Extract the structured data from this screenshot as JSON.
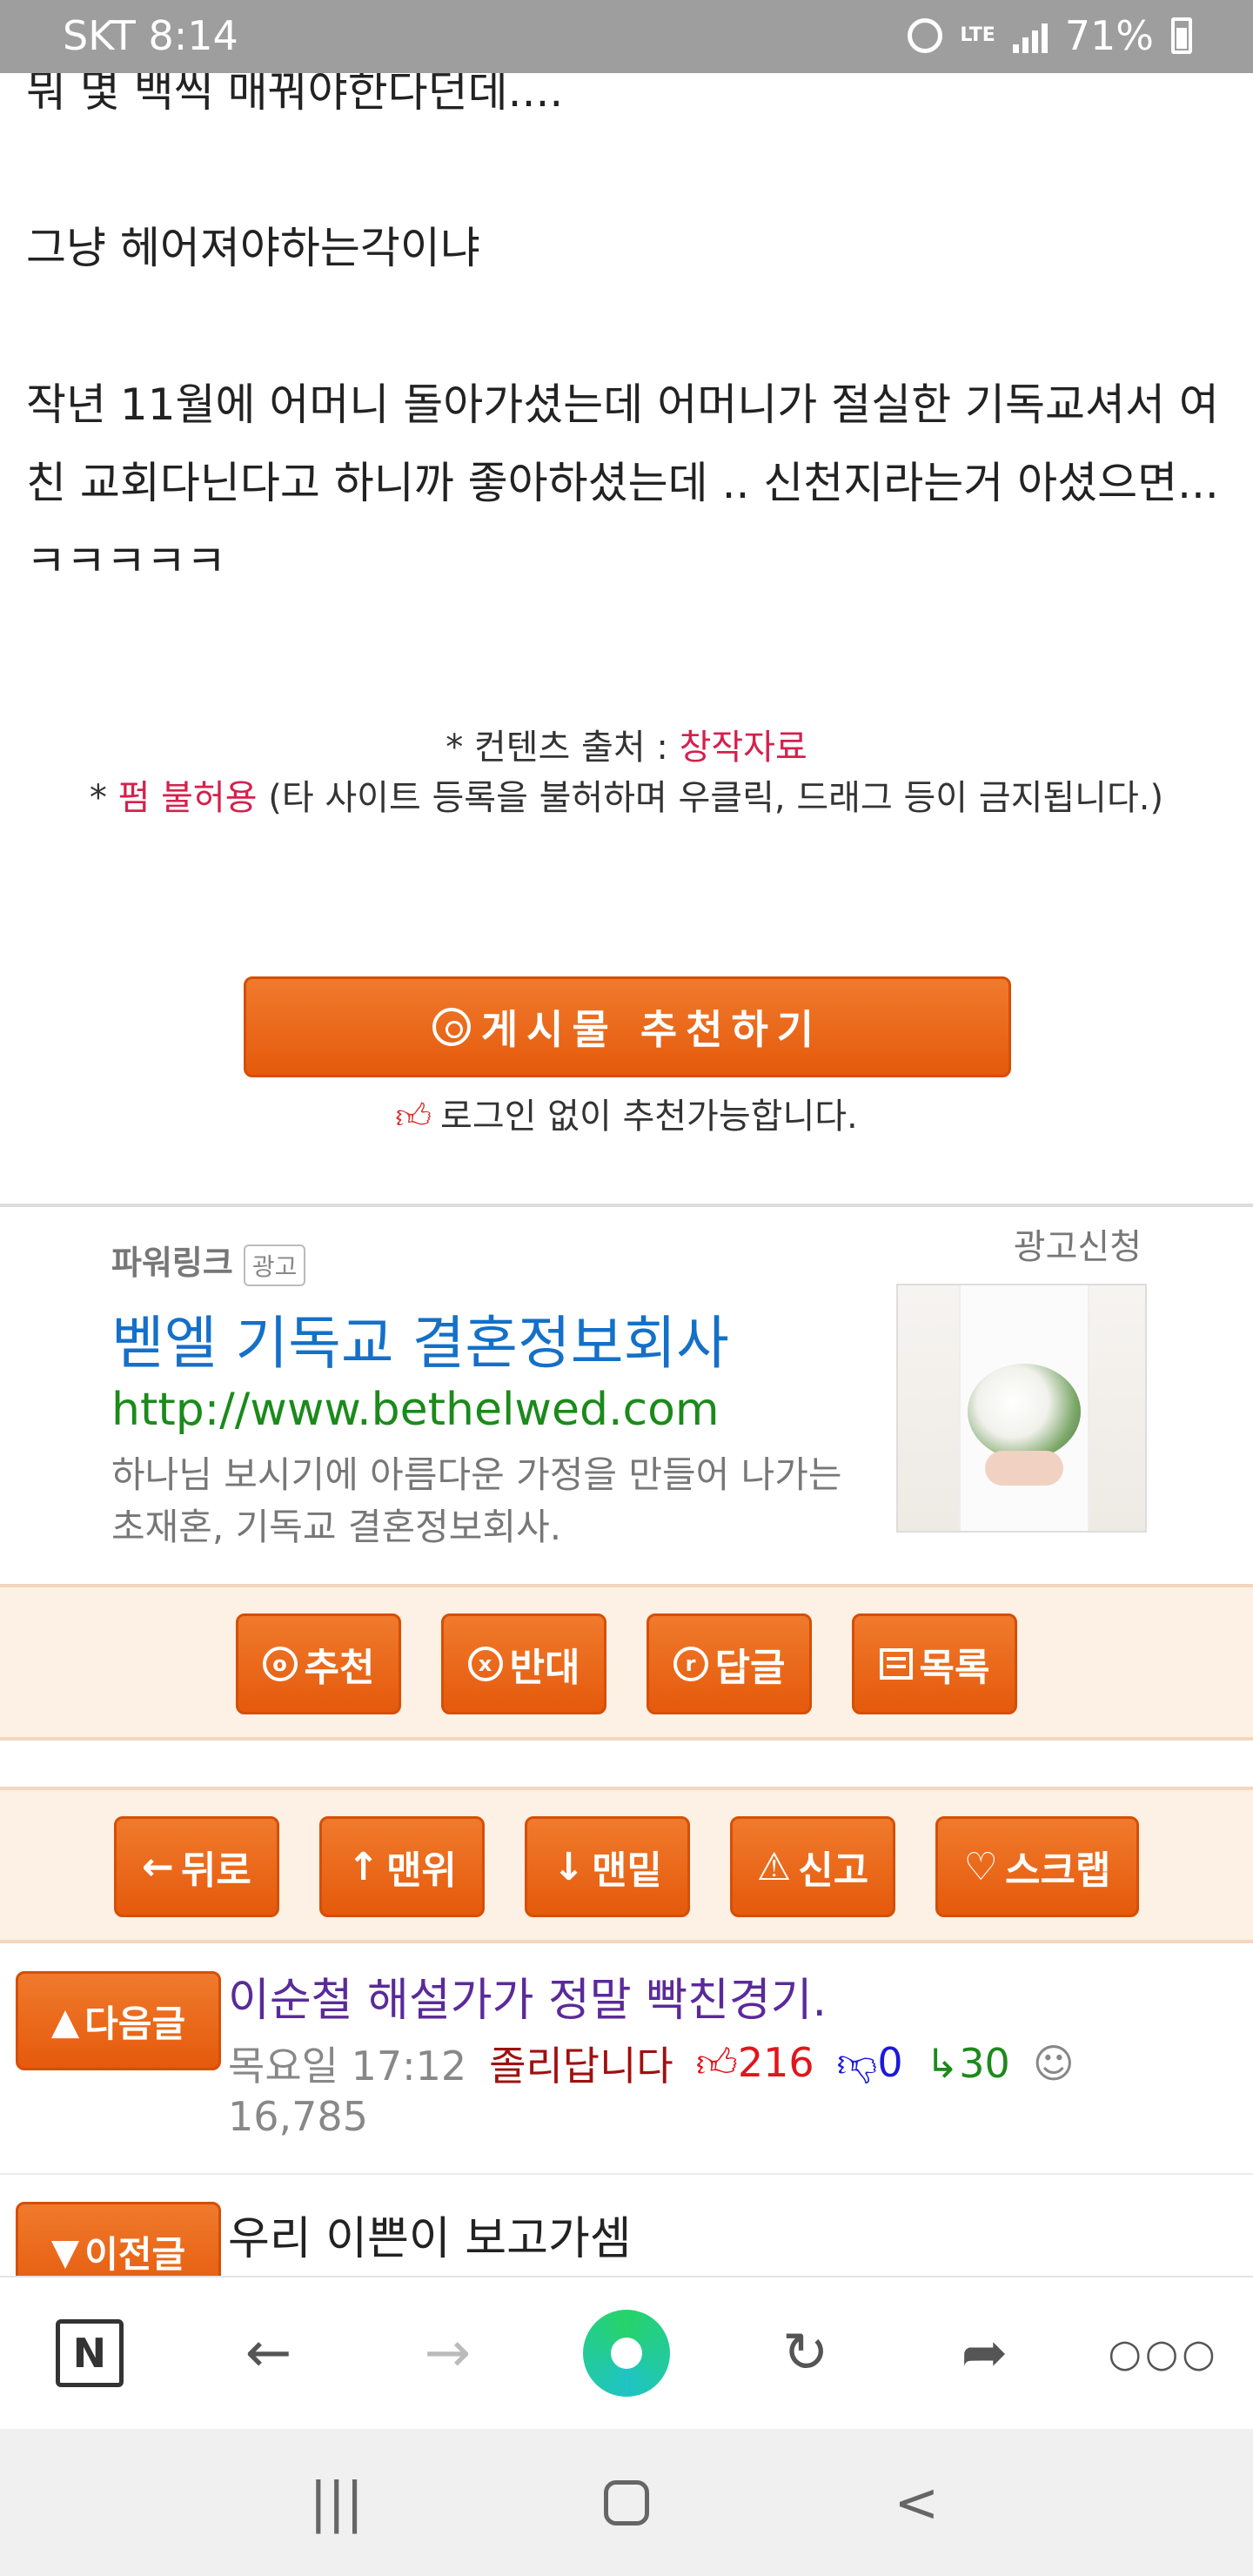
{
  "status_bar": {
    "carrier_time": "SKT 8:14",
    "network": "LTE",
    "battery": "71%"
  },
  "article": {
    "paragraphs": [
      "뭐 몇 백씩 매꿔야한다던데....",
      "그냥 헤어져야하는각이냐",
      "작년 11월에 어머니 돌아가셨는데 어머니가 절실한 기독교셔서 여친 교회다닌다고 하니까 좋아하셨는데 .. 신천지라는거 아셨으면...ㅋㅋㅋㅋㅋ"
    ]
  },
  "source_note": {
    "line1_prefix": "* 컨텐츠 출처 : ",
    "line1_link": "창작자료",
    "line2_prefix": "* ",
    "line2_link": "펌 불허용",
    "line2_suffix": " (타 사이트 등록을 불허하며 우클릭, 드래그 등이 금지됩니다.)"
  },
  "recommend": {
    "button_label": "게시물  추천하기",
    "note": "로그인 없이 추천가능합니다."
  },
  "ad": {
    "powerlink": "파워링크",
    "tag": "광고",
    "apply": "광고신청",
    "title": "벧엘 기독교 결혼정보회사",
    "url": "http://www.bethelwed.com",
    "description": "하나님 보시기에 아름다운 가정을 만들어 나가는 초재혼, 기독교 결혼정보회사."
  },
  "actions": [
    {
      "icon": "o",
      "label": "추천"
    },
    {
      "icon": "x",
      "label": "반대"
    },
    {
      "icon": "r",
      "label": "답글"
    },
    {
      "icon": "list",
      "label": "목록"
    }
  ],
  "nav_actions": [
    {
      "icon": "←",
      "label": "뒤로"
    },
    {
      "icon": "↑",
      "label": "맨위"
    },
    {
      "icon": "↓",
      "label": "맨밑"
    },
    {
      "icon": "⚠",
      "label": "신고"
    },
    {
      "icon": "♡",
      "label": "스크랩"
    }
  ],
  "next_post": {
    "button": "다음글",
    "title": "이순철 해설가가 정말 빡친경기.",
    "time": "목요일 17:12",
    "author": "졸리답니다",
    "upvotes": "216",
    "downvotes": "0",
    "replies": "30",
    "views": "16,785"
  },
  "prev_post": {
    "button": "이전글",
    "title": "우리 이쁜이 보고가셈"
  },
  "browser_toolbar": {
    "n_label": "N"
  },
  "colors": {
    "accent_orange": "#e8620f",
    "ad_blue": "#1470c8",
    "ad_green": "#1b8a1b",
    "highlight_red": "#d4214c"
  }
}
